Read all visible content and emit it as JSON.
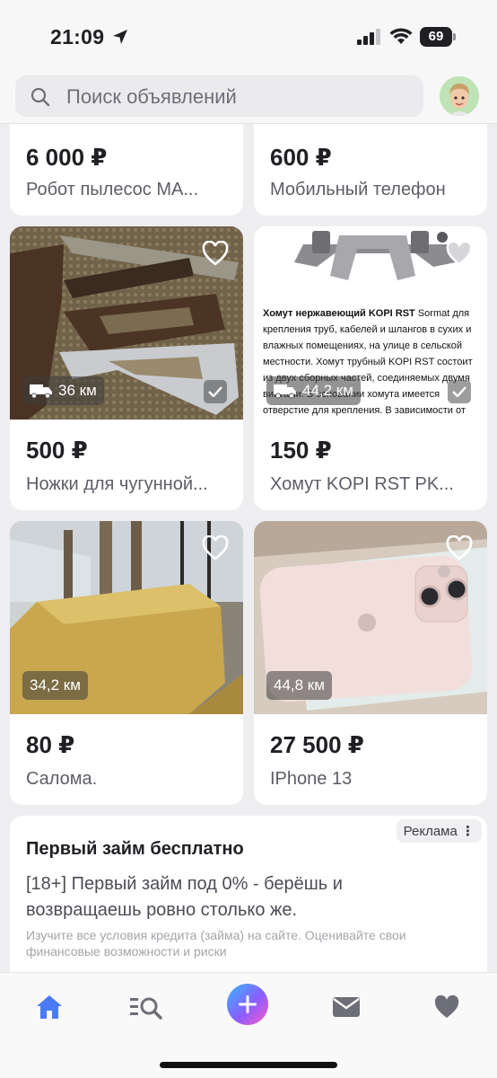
{
  "status_bar": {
    "time": "21:09",
    "battery": "69"
  },
  "search": {
    "placeholder": "Поиск объявлений"
  },
  "listings": [
    {
      "price": "6 000 ₽",
      "title": "Робот пылесос МА..."
    },
    {
      "price": "600 ₽",
      "title": "Мобильный телефон"
    },
    {
      "price": "500 ₽",
      "title": "Ножки для чугунной...",
      "distance": "36 км"
    },
    {
      "price": "150 ₽",
      "title": "Хомут KOPI RST PK...",
      "distance": "44,2 км",
      "photo_text": {
        "bold": "Хомут нержавеющий KOPI RST",
        "rest": " Sormat для крепления труб, кабелей и шлангов в сухих и влажных помещениях, на улице в сельской местности. Хомут трубный KOPI RST состоит из двух сборных частей, соединяемых двумя винтами. В основании хомута имеется отверстие для крепления. В зависимости от материала несущей конструкции нержавеющий хомут KOPI"
      }
    },
    {
      "price": "80 ₽",
      "title": "Салома.",
      "distance": "34,2 км"
    },
    {
      "price": "27 500 ₽",
      "title": "IPhone 13",
      "distance": "44,8 км"
    }
  ],
  "ad": {
    "tag": "Реклама",
    "title": "Первый займ бесплатно",
    "body": "[18+] Первый займ под 0% - берёшь и возвращаешь ровно столько же.",
    "fine_print": "Изучите все условия кредита (займа) на сайте. Оценивайте свои финансовые возможности и риски"
  },
  "tabbar": {
    "tabs": [
      {
        "icon": "home-icon",
        "active": true
      },
      {
        "icon": "categories-search-icon"
      },
      {
        "icon": "add-icon"
      },
      {
        "icon": "mail-icon"
      },
      {
        "icon": "heart-icon"
      }
    ]
  },
  "colors": {
    "accent": "#4a7bf5",
    "price": "#1f1f24",
    "page_bg": "#eeeef1"
  }
}
